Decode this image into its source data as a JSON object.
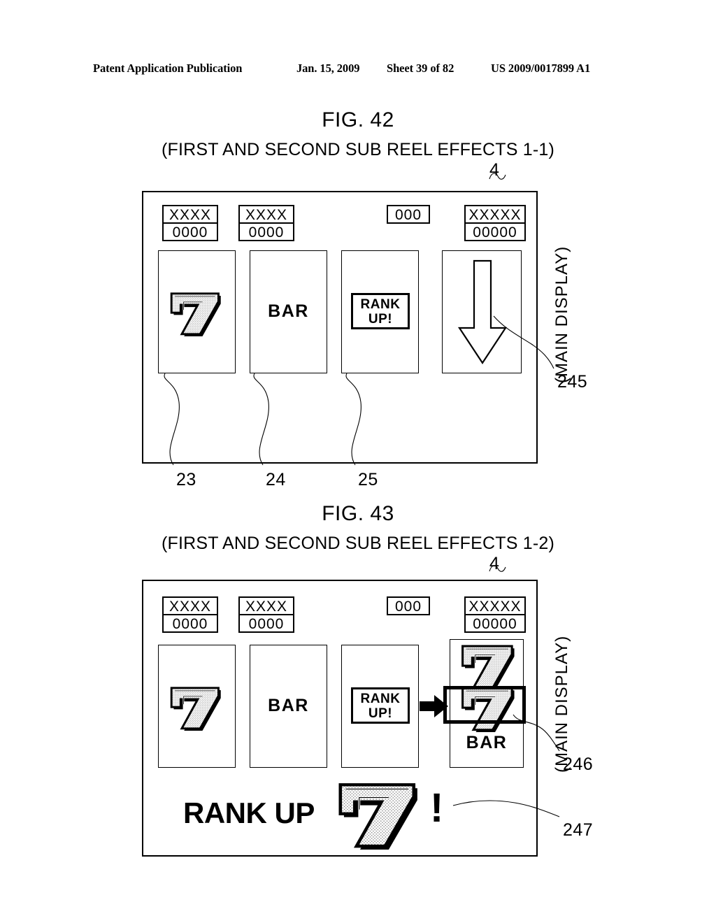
{
  "page_header": {
    "publication": "Patent Application Publication",
    "date": "Jan. 15, 2009",
    "sheet": "Sheet 39 of 82",
    "patent_number": "US 2009/0017899 A1"
  },
  "figures": [
    {
      "id": "fig-42",
      "title": "FIG. 42",
      "subtitle": "(FIRST AND SECOND SUB REEL EFFECTS 1-1)",
      "frame_callout": "4",
      "side_label": "(MAIN DISPLAY)",
      "info_boxes": [
        {
          "top": "XXXX",
          "bottom": "0000"
        },
        {
          "top": "XXXX",
          "bottom": "0000"
        },
        {
          "top": "000",
          "bottom": null
        },
        {
          "top": "XXXXX",
          "bottom": "00000"
        }
      ],
      "reels": [
        {
          "name": "reel-1",
          "symbol": "seven"
        },
        {
          "name": "reel-2",
          "symbol": "text",
          "text": "BAR"
        },
        {
          "name": "reel-3",
          "symbol": "rankup-box",
          "text_line1": "RANK",
          "text_line2": "UP!"
        },
        {
          "name": "reel-4",
          "symbol": "down-arrow"
        }
      ],
      "ref_numbers": [
        "23",
        "24",
        "25",
        "245"
      ]
    },
    {
      "id": "fig-43",
      "title": "FIG. 43",
      "subtitle": "(FIRST AND SECOND SUB REEL EFFECTS 1-2)",
      "frame_callout": "4",
      "side_label": "(MAIN DISPLAY)",
      "info_boxes": [
        {
          "top": "XXXX",
          "bottom": "0000"
        },
        {
          "top": "XXXX",
          "bottom": "0000"
        },
        {
          "top": "000",
          "bottom": null
        },
        {
          "top": "XXXXX",
          "bottom": "00000"
        }
      ],
      "reels": [
        {
          "name": "reel-1",
          "symbol": "seven"
        },
        {
          "name": "reel-2",
          "symbol": "text",
          "text": "BAR"
        },
        {
          "name": "reel-3",
          "symbol": "rankup-box",
          "text_line1": "RANK",
          "text_line2": "UP!"
        },
        {
          "name": "reel-4",
          "symbol": "stack",
          "stack": [
            "seven",
            "seven-highlighted",
            "BAR"
          ]
        }
      ],
      "banner": {
        "text": "RANK UP",
        "symbol": "seven",
        "exclamation": "!"
      },
      "ref_numbers": [
        "246",
        "247"
      ]
    }
  ],
  "colors": {
    "ink": "#000000",
    "paper": "#ffffff",
    "seven_fill": "#e8e8e8"
  }
}
